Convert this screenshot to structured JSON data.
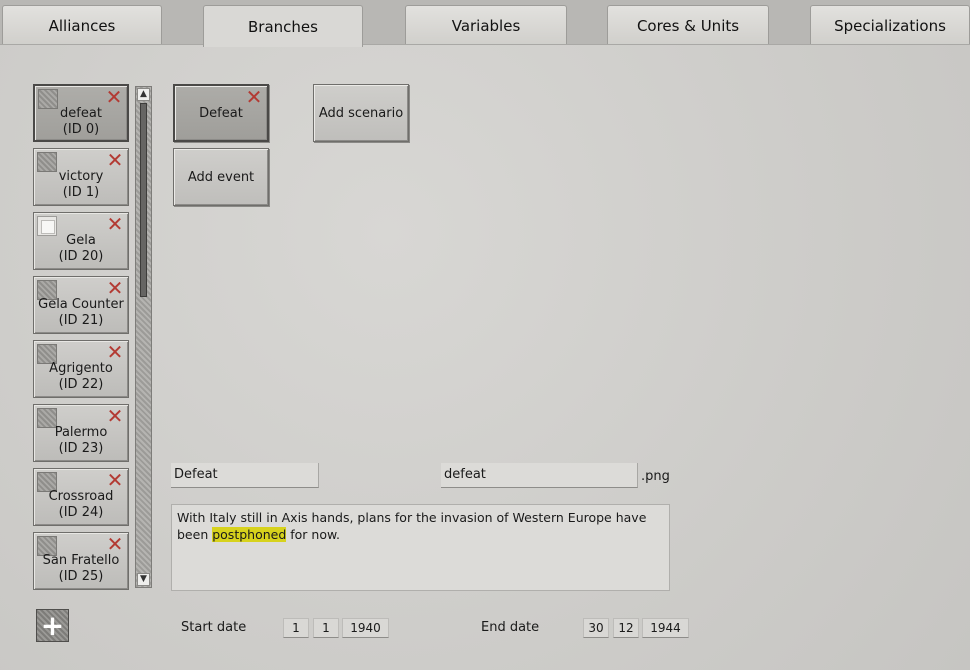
{
  "tabs": [
    {
      "label": "Alliances"
    },
    {
      "label": "Branches"
    },
    {
      "label": "Variables"
    },
    {
      "label": "Cores & Units"
    },
    {
      "label": "Specializations"
    }
  ],
  "active_tab": "Branches",
  "branches": [
    {
      "name": "defeat",
      "id": "(ID 0)"
    },
    {
      "name": "victory",
      "id": "(ID 1)"
    },
    {
      "name": "Gela",
      "id": "(ID 20)"
    },
    {
      "name": "Gela Counter",
      "id": "(ID 21)"
    },
    {
      "name": "Agrigento",
      "id": "(ID 22)"
    },
    {
      "name": "Palermo",
      "id": "(ID 23)"
    },
    {
      "name": "Crossroad",
      "id": "(ID 24)"
    },
    {
      "name": "San Fratello",
      "id": "(ID 25)"
    }
  ],
  "scenario_button": {
    "label": "Defeat"
  },
  "add_scenario_label": "Add scenario",
  "add_event_label": "Add event",
  "editor": {
    "title_value": "Defeat",
    "image_value": "defeat",
    "image_ext": ".png",
    "description_before": "With Italy still in Axis hands, plans for the invasion of Western Europe have been ",
    "description_highlight": "postphoned",
    "description_after": " for now."
  },
  "dates": {
    "start_label": "Start date",
    "start_day": "1",
    "start_month": "1",
    "start_year": "1940",
    "end_label": "End date",
    "end_day": "30",
    "end_month": "12",
    "end_year": "1944"
  },
  "colors": {
    "highlight": "#d7d21c",
    "delete_x": "#b33a33"
  },
  "icons": {
    "delete": "close-icon",
    "add": "plus-icon"
  }
}
